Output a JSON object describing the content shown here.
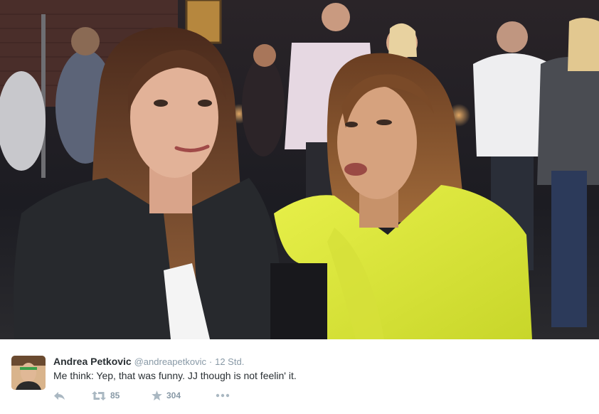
{
  "tweet": {
    "display_name": "Andrea Petkovic",
    "handle": "@andreapetkovic",
    "separator": "·",
    "time": "12 Std.",
    "text": "Me think: Yep, that was funny. JJ though is not feelin' it.",
    "retweet_count": "85",
    "favorite_count": "304"
  },
  "colors": {
    "name": "#292f33",
    "muted": "#8899a6",
    "icon": "#aab8c2",
    "background": "#ffffff"
  },
  "icons": {
    "reply": "reply-icon",
    "retweet": "retweet-icon",
    "favorite": "star-icon",
    "more": "more-icon"
  }
}
